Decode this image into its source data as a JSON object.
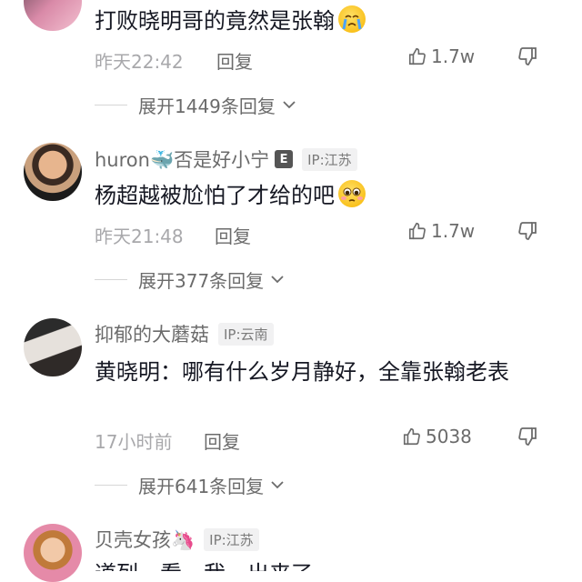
{
  "comments": [
    {
      "username": "",
      "ip": "",
      "text": "打败晓明哥的竟然是张翰",
      "emoji": "crying-face",
      "time": "昨天22:42",
      "reply_label": "回复",
      "likes": "1.7w",
      "expand": "展开1449条回复"
    },
    {
      "username": "huron🐳否是好小宁",
      "badge": "E",
      "ip": "IP:江苏",
      "text": "杨超越被尬怕了才给的吧",
      "emoji": "pleading-face",
      "time": "昨天21:48",
      "reply_label": "回复",
      "likes": "1.7w",
      "expand": "展开377条回复"
    },
    {
      "username": "抑郁的大蘑菇",
      "ip": "IP:云南",
      "text": "黄晓明：哪有什么岁月静好，全靠张翰老表",
      "time": "17小时前",
      "reply_label": "回复",
      "likes": "5038",
      "expand": "展开641条回复"
    },
    {
      "username": "贝壳女孩🦄",
      "ip": "IP:江苏",
      "text": "道列…看…我…出来了"
    }
  ]
}
